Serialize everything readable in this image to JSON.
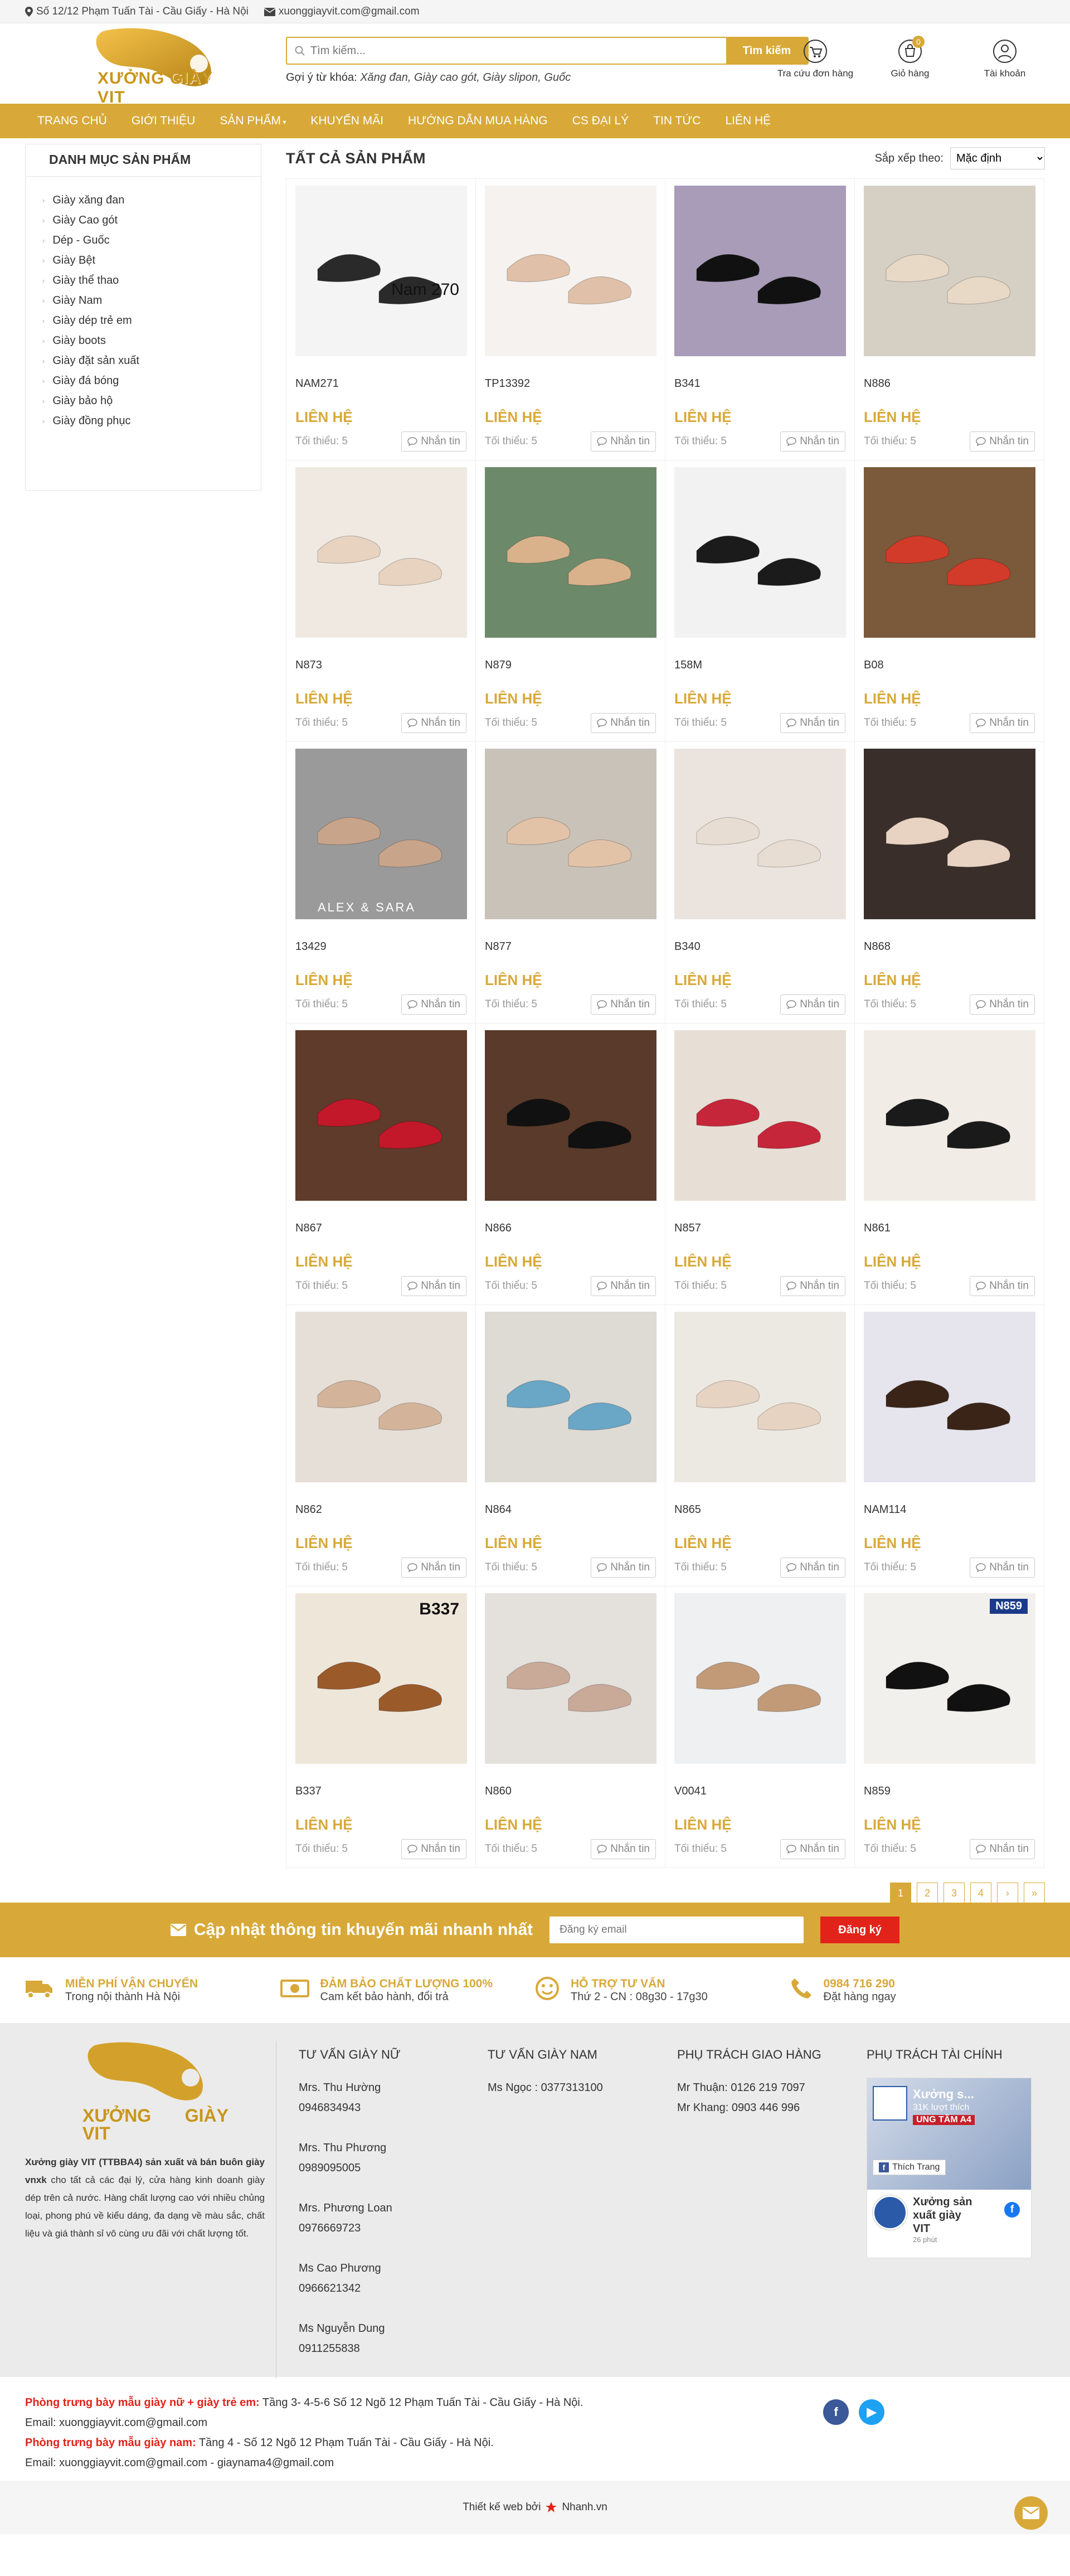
{
  "topbar": {
    "address": "Số 12/12 Phạm Tuấn Tài - Cầu Giấy - Hà Nội",
    "email": "xuonggiayvit.com@gmail.com"
  },
  "header": {
    "logo_text": "XƯỞNG GIÀY VIT",
    "search_placeholder": "Tìm kiếm...",
    "search_button": "Tìm kiếm",
    "suggest_label": "Gợi ý từ khóa:",
    "suggest_keywords": "Xăng đan, Giày cao gót, Giày slipon, Guốc",
    "actions": [
      {
        "label": "Tra cứu đơn hàng",
        "icon": "order-lookup-icon"
      },
      {
        "label": "Giỏ hàng",
        "icon": "cart-icon",
        "count": "0"
      },
      {
        "label": "Tài khoản",
        "icon": "account-icon"
      }
    ]
  },
  "nav": [
    "TRANG CHỦ",
    "GIỚI THIỆU",
    "SẢN PHẨM",
    "KHUYẾN MÃI",
    "HƯỚNG DẪN MUA HÀNG",
    "CS ĐẠI LÝ",
    "TIN TỨC",
    "LIÊN HỆ"
  ],
  "sidebar": {
    "title": "DANH MỤC SẢN PHẨM",
    "items": [
      "Giày xăng đan",
      "Giày Cao gót",
      "Dép - Guốc",
      "Giày Bệt",
      "Giày thể thao",
      "Giày Nam",
      "Giày dép trẻ em",
      "Giày boots",
      "Giày đặt sản xuất",
      "Giày đá bóng",
      "Giày bảo hộ",
      "Giày đồng phục"
    ]
  },
  "content": {
    "title": "TẤT CẢ SẢN PHẨM",
    "sort_label": "Sắp xếp theo:",
    "sort_value": "Mặc định",
    "price_label": "LIÊN HỆ",
    "min_label": "Tối thiểu: 5",
    "chat_label": "Nhắn tin",
    "products": [
      {
        "name": "NAM271",
        "img_text": "Nam 270",
        "bg": "#f4f4f4",
        "shoe": "#2a2a2a"
      },
      {
        "name": "TP13392",
        "img_text": "",
        "bg": "#f5f2ef",
        "shoe": "#e0c0a8"
      },
      {
        "name": "B341",
        "img_text": "",
        "bg": "#a89cb8",
        "shoe": "#111111"
      },
      {
        "name": "N886",
        "img_text": "",
        "bg": "#d6cfc4",
        "shoe": "#e8d9c6"
      },
      {
        "name": "N873",
        "img_text": "",
        "bg": "#efe9e2",
        "shoe": "#e7d3c0"
      },
      {
        "name": "N879",
        "img_text": "",
        "bg": "#6c8a6a",
        "shoe": "#d9b28c"
      },
      {
        "name": "158M",
        "img_text": "",
        "bg": "#f2f2f2",
        "shoe": "#1b1b1b"
      },
      {
        "name": "B08",
        "img_text": "",
        "bg": "#7a5a3a",
        "shoe": "#d23a2a"
      },
      {
        "name": "13429",
        "img_text": "ALEX & SARA",
        "bg": "#9a9a9a",
        "shoe": "#c8a48a"
      },
      {
        "name": "N877",
        "img_text": "",
        "bg": "#c9c2b8",
        "shoe": "#e3c3a8"
      },
      {
        "name": "B340",
        "img_text": "",
        "bg": "#ebe4de",
        "shoe": "#e8ddd2"
      },
      {
        "name": "N868",
        "img_text": "",
        "bg": "#3a2e2a",
        "shoe": "#e8d2c2"
      },
      {
        "name": "N867",
        "img_text": "",
        "bg": "#5e3b2a",
        "shoe": "#c2182a"
      },
      {
        "name": "N866",
        "img_text": "",
        "bg": "#5a3a2a",
        "shoe": "#111111"
      },
      {
        "name": "N857",
        "img_text": "",
        "bg": "#e7dfd6",
        "shoe": "#c5263a"
      },
      {
        "name": "N861",
        "img_text": "",
        "bg": "#f1ece6",
        "shoe": "#1a1a1a"
      },
      {
        "name": "N862",
        "img_text": "",
        "bg": "#e5dfd8",
        "shoe": "#d3b49a"
      },
      {
        "name": "N864",
        "img_text": "",
        "bg": "#dedad4",
        "shoe": "#6aa6c6"
      },
      {
        "name": "N865",
        "img_text": "",
        "bg": "#ece8e2",
        "shoe": "#e7d3c2"
      },
      {
        "name": "NAM114",
        "img_text": "",
        "bg": "#e6e4ec",
        "shoe": "#3a2418"
      },
      {
        "name": "B337",
        "img_text": "B337",
        "bg": "#efe6da",
        "shoe": "#9a5a2a"
      },
      {
        "name": "N860",
        "img_text": "",
        "bg": "#e4e0dc",
        "shoe": "#c9a998"
      },
      {
        "name": "V0041",
        "img_text": "",
        "bg": "#eef0f2",
        "shoe": "#c29a78"
      },
      {
        "name": "N859",
        "img_text": "N859",
        "bg": "#f2f0ec",
        "shoe": "#111111"
      }
    ],
    "pagination": [
      "1",
      "2",
      "3",
      "4",
      "›",
      "»"
    ]
  },
  "newsletter": {
    "title": "Cập nhật thông tin khuyến mãi nhanh nhất",
    "placeholder": "Đăng ký email",
    "button": "Đăng ký"
  },
  "policies": [
    {
      "title": "MIỄN PHÍ VẬN CHUYỂN",
      "sub": "Trong nội thành Hà Nội",
      "icon": "truck-icon"
    },
    {
      "title": "ĐẢM BẢO CHẤT LƯỢNG 100%",
      "sub": "Cam kết bảo hành, đổi trả",
      "icon": "money-icon"
    },
    {
      "title": "HỖ TRỢ TƯ VẤN",
      "sub": "Thứ 2 - CN : 08g30 - 17g30",
      "icon": "smile-icon"
    },
    {
      "title": "0984 716 290",
      "sub": "Đặt hàng ngay",
      "icon": "phone-icon"
    }
  ],
  "footer": {
    "logo_text": "XƯỞNG GIÀY VIT",
    "about_bold": "Xưởng giày VIT (TTBBA4) sản xuất và bán buôn giày vnxk",
    "about": "cho tất cả các đại lý, cửa hàng kinh doanh giày dép trên cả nước. Hàng chất lượng cao với nhiều chủng loại, phong phú về kiểu dáng, đa dạng về màu sắc, chất liệu và giá thành sỉ vô cùng ưu đãi với chất lượng tốt.",
    "col_women_title": "TƯ VẤN GIÀY NỮ",
    "women": [
      {
        "name": "Mrs. Thu Hường",
        "phone": "0946834943"
      },
      {
        "name": "Mrs. Thu Phương",
        "phone": "0989095005"
      },
      {
        "name": "Mrs. Phương Loan",
        "phone": "0976669723"
      },
      {
        "name": "Ms Cao Phương",
        "phone": "0966621342"
      },
      {
        "name": "Ms Nguyễn Dung",
        "phone": "0911255838"
      }
    ],
    "col_men_title": "TƯ VẤN GIÀY NAM",
    "men": "Ms Ngọc : 0377313100",
    "col_ship_title": "PHỤ TRÁCH GIAO HÀNG",
    "ship": [
      "Mr Thuận: 0126 219 7097",
      "Mr Khang: 0903 446 996"
    ],
    "col_fin_title": "PHỤ TRÁCH TÀI CHÍNH",
    "fb_page": "Xưởng s...",
    "fb_likes": "31K lượt thích",
    "fb_banner": "UNG TÂM A4",
    "fb_like_btn": "Thích Trang",
    "fb_post_name": "Xưởng sản xuất giày VIT",
    "fb_post_time": "26 phút"
  },
  "footer_bottom": {
    "line1_red": "Phòng trưng bày mẫu giày nữ + giày trẻ em:",
    "line1": "Tầng 3- 4-5-6 Số 12 Ngõ 12 Phạm Tuấn Tài - Cầu Giấy - Hà Nội.",
    "line2": "Email: xuonggiayvit.com@gmail.com",
    "line3_red": "Phòng trưng bày mẫu giày nam:",
    "line3": "Tầng 4 - Số 12 Ngõ 12 Phạm Tuấn Tài - Cầu Giấy - Hà Nội.",
    "line4": "Email: xuonggiayvit.com@gmail.com - giaynama4@gmail.com",
    "designed": "Thiết kế web bởi",
    "designed_brand": "Nhanh.vn"
  }
}
